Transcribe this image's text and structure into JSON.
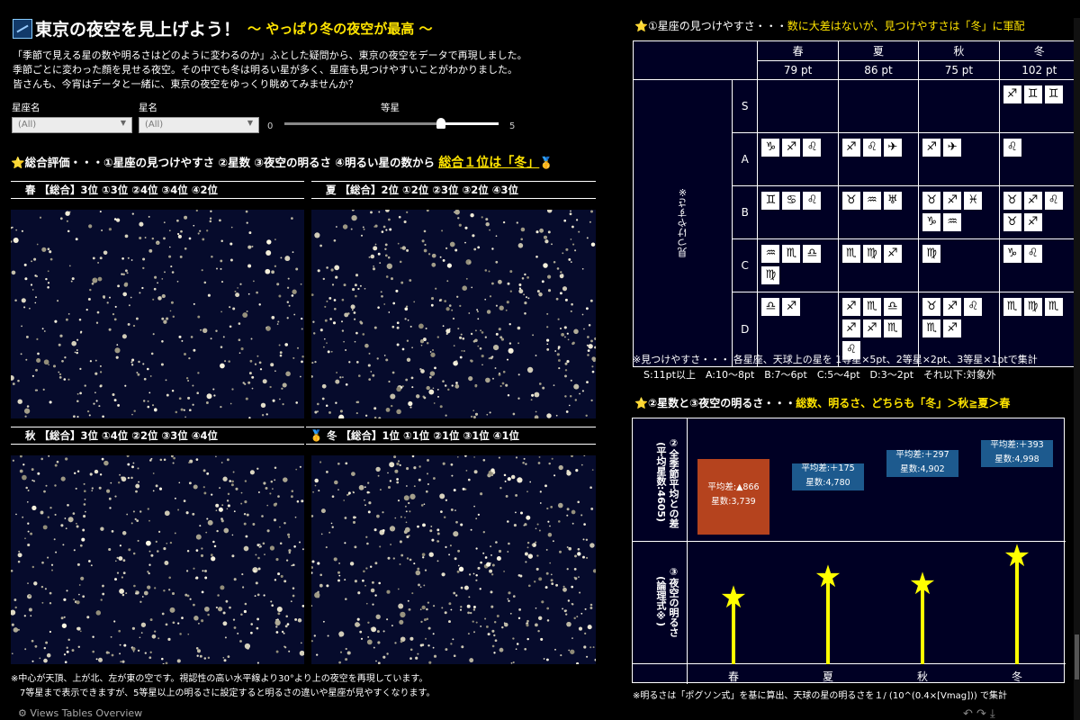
{
  "title": {
    "main": "東京の夜空を見上げよう！",
    "sub": "〜 やっぱり冬の夜空が最高 〜"
  },
  "intro": [
    "「季節で見える星の数や明るさはどのように変わるのか」ふとした疑問から、東京の夜空をデータで再現しました。",
    "季節ごとに変わった顔を見せる夜空。その中でも冬は明るい星が多く、星座も見つけやすいことがわかりました。",
    "皆さんも、今宵はデータと一緒に、東京の夜空をゆっくり眺めてみませんか？"
  ],
  "filters": {
    "constellation": {
      "label": "星座名",
      "value": "(All)"
    },
    "star": {
      "label": "星名",
      "value": "(All)"
    },
    "magnitude": {
      "label": "等星",
      "min": "0",
      "max": "5",
      "value": 4
    }
  },
  "overall": {
    "prefix": "⭐総合評価・・・①星座の見つけやすさ ②星数 ③夜空の明るさ ④明るい星の数から ",
    "highlight": "総合１位は「冬」",
    "medal": "🥇"
  },
  "skies": [
    {
      "header": "春 【総合】3位 ①3位 ②4位 ③4位 ④2位",
      "medal": ""
    },
    {
      "header": "夏 【総合】2位 ①2位 ②3位 ③2位 ④3位",
      "medal": ""
    },
    {
      "header": "秋 【総合】3位 ①4位 ②2位 ③3位 ④4位",
      "medal": ""
    },
    {
      "header": "冬 【総合】1位 ①1位 ②1位 ③1位 ④1位",
      "medal": "🥇"
    }
  ],
  "left_foot": [
    "※中心が天頂、上が北、左が東の空です。視認性の高い水平線より30°より上の夜空を再現しています。",
    "7等星まで表示できますが、5等星以上の明るさに設定すると明るさの違いや星座が見やすくなります。"
  ],
  "visibility": {
    "title_prefix": "⭐①星座の見つけやすさ・・・",
    "title_highlight": "数に大差はないが、見つけやすさは「冬」に軍配",
    "row_axis_label": "見つけやすさ※",
    "seasons": [
      "春",
      "夏",
      "秋",
      "冬"
    ],
    "points": [
      "79 pt",
      "86 pt",
      "75 pt",
      "102 pt"
    ],
    "rows": [
      {
        "grade": "S",
        "cells": [
          [],
          [],
          [],
          [
            "♐",
            "♊",
            "♊"
          ]
        ]
      },
      {
        "grade": "A",
        "cells": [
          [
            "♑",
            "♐",
            "♌"
          ],
          [
            "♐",
            "♌",
            "✈"
          ],
          [
            "♐",
            "✈"
          ],
          [
            "♌"
          ]
        ]
      },
      {
        "grade": "B",
        "cells": [
          [
            "♊",
            "♋",
            "♌"
          ],
          [
            "♉",
            "♒",
            "♅"
          ],
          [
            "♉",
            "♐",
            "♓",
            "♑",
            "♒"
          ],
          [
            "♉",
            "♐",
            "♌",
            "♉",
            "♐"
          ]
        ]
      },
      {
        "grade": "C",
        "cells": [
          [
            "♒",
            "♏",
            "♎",
            "♍"
          ],
          [
            "♏",
            "♍",
            "♐"
          ],
          [
            "♍"
          ],
          [
            "♑",
            "♌"
          ]
        ]
      },
      {
        "grade": "D",
        "cells": [
          [
            "♎",
            "♐"
          ],
          [
            "♐",
            "♏",
            "♎",
            "♐",
            "♐",
            "♏",
            "♌"
          ],
          [
            "♉",
            "♐",
            "♌",
            "♏",
            "♐"
          ],
          [
            "♏",
            "♍",
            "♏"
          ]
        ]
      }
    ],
    "notes": [
      "※見つけやすさ・・・ 各星座、天球上の星を 1等星×5pt、2等星×2pt、3等星×1ptで集計",
      "S:11pt以上　A:10〜8pt　B:7〜6pt　C:5〜4pt　D:3〜2pt　それ以下:対象外"
    ]
  },
  "brightness": {
    "title_prefix": "⭐②星数と③夜空の明るさ・・・",
    "title_highlight": "総数、明るさ、どちらも「冬」＞秋≧夏＞春",
    "axis1": "②全季節平均との差\n(平均星数:4605)",
    "axis2": "③夜空の明るさ\n(論理式※)",
    "colors": {
      "negative": "#b5431e",
      "positive": "#1d5a8e",
      "star": "#ffff00"
    },
    "chart_data": {
      "type": "bar",
      "categories": [
        "春",
        "夏",
        "秋",
        "冬"
      ],
      "series": [
        {
          "name": "平均差",
          "values": [
            -866,
            175,
            297,
            393
          ]
        },
        {
          "name": "星数",
          "values": [
            3739,
            4780,
            4902,
            4998
          ]
        }
      ],
      "labels": [
        [
          "平均差:▲866",
          "星数:3,739"
        ],
        [
          "平均差:＋175",
          "星数:4,780"
        ],
        [
          "平均差:＋297",
          "星数:4,902"
        ],
        [
          "平均差:＋393",
          "星数:4,998"
        ]
      ],
      "brightness": [
        0.55,
        0.73,
        0.67,
        0.9
      ]
    },
    "note": "※明るさは「ポグソン式」を基に算出、天球の星の明るさを１/ (10^(0.4×[Vmag])) で集計"
  },
  "bottom_bar": {
    "left": "⚙ Views  Tables  Overview",
    "tools": "↶  ↷  ⤓"
  }
}
